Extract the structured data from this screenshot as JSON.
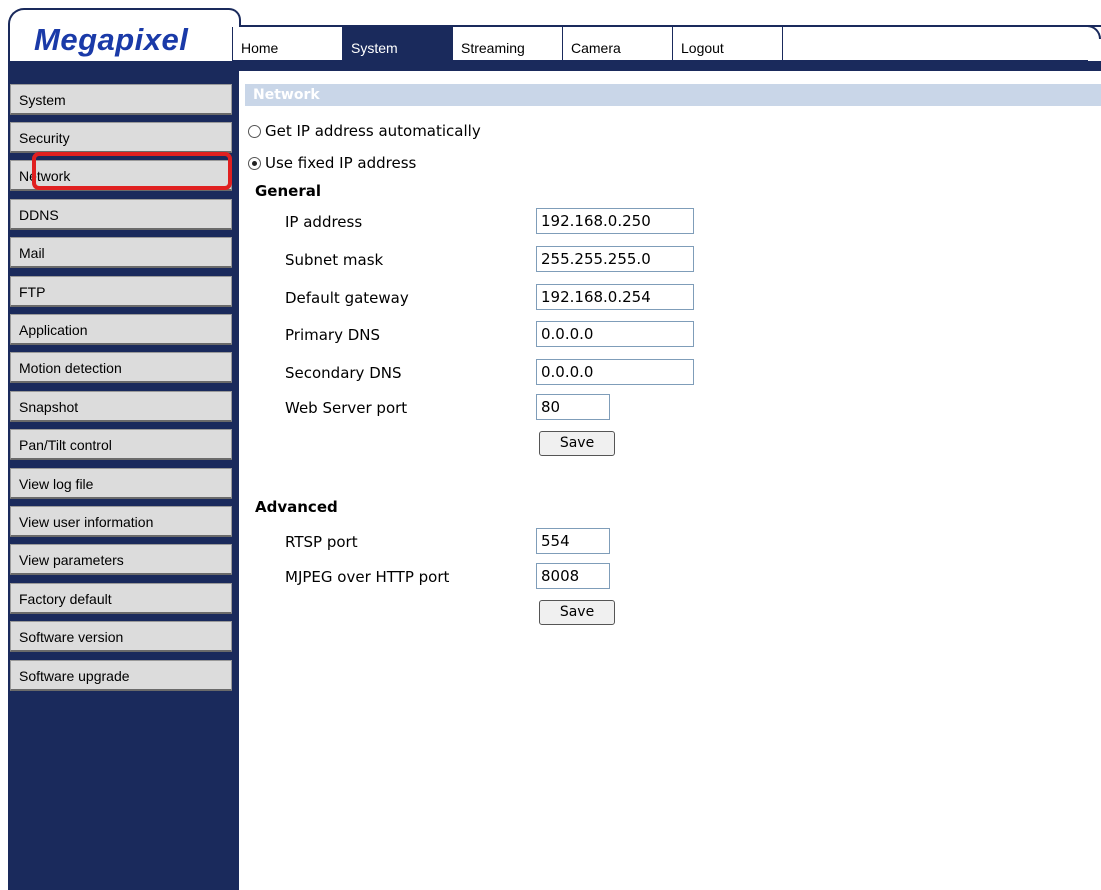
{
  "brand": {
    "logo_text": "Megapixel"
  },
  "tabs": [
    {
      "label": "Home"
    },
    {
      "label": "System"
    },
    {
      "label": "Streaming"
    },
    {
      "label": "Camera"
    },
    {
      "label": "Logout"
    }
  ],
  "active_tab": "System",
  "sidebar": {
    "selected": "Network",
    "items": [
      {
        "label": "System"
      },
      {
        "label": "Security"
      },
      {
        "label": "Network"
      },
      {
        "label": "DDNS"
      },
      {
        "label": "Mail"
      },
      {
        "label": "FTP"
      },
      {
        "label": "Application"
      },
      {
        "label": "Motion detection"
      },
      {
        "label": "Snapshot"
      },
      {
        "label": "Pan/Tilt control"
      },
      {
        "label": "View log file"
      },
      {
        "label": "View user information"
      },
      {
        "label": "View parameters"
      },
      {
        "label": "Factory default"
      },
      {
        "label": "Software version"
      },
      {
        "label": "Software upgrade"
      }
    ]
  },
  "main": {
    "section_title": "Network",
    "ip_mode": {
      "auto_label": "Get IP address automatically",
      "fixed_label": "Use fixed IP address",
      "selected": "fixed"
    },
    "general": {
      "heading": "General",
      "ip_address": {
        "label": "IP address",
        "value": "192.168.0.250"
      },
      "subnet_mask": {
        "label": "Subnet mask",
        "value": "255.255.255.0"
      },
      "default_gateway": {
        "label": "Default gateway",
        "value": "192.168.0.254"
      },
      "primary_dns": {
        "label": "Primary DNS",
        "value": "0.0.0.0"
      },
      "secondary_dns": {
        "label": "Secondary DNS",
        "value": "0.0.0.0"
      },
      "web_server_port": {
        "label": "Web Server port",
        "value": "80"
      },
      "save_label": "Save"
    },
    "advanced": {
      "heading": "Advanced",
      "rtsp_port": {
        "label": "RTSP port",
        "value": "554"
      },
      "mjpeg_port": {
        "label": "MJPEG over HTTP port",
        "value": "8008"
      },
      "save_label": "Save"
    }
  },
  "colors": {
    "navy": "#1a2a5c",
    "logo_blue": "#1a3aa8",
    "section_bar": "#c9d6e8",
    "highlight_red": "#e02020",
    "sidebar_item": "#dcdcdc"
  }
}
